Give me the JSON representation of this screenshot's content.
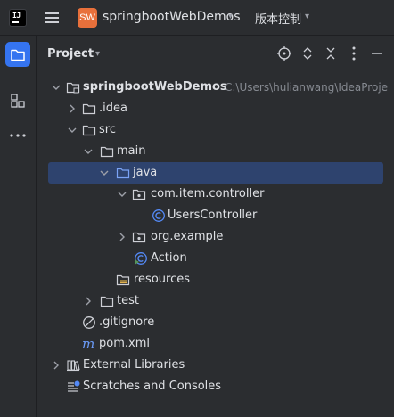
{
  "titlebar": {
    "logo_text": "IJ",
    "project_badge": "SW",
    "project_name": "springbootWebDemos",
    "vcs_label": "版本控制"
  },
  "panel": {
    "title": "Project"
  },
  "tree": {
    "root": {
      "label": "springbootWebDemos",
      "path": "C:\\Users\\hulianwang\\IdeaProje"
    },
    "idea": {
      "label": ".idea"
    },
    "src": {
      "label": "src"
    },
    "main": {
      "label": "main"
    },
    "java": {
      "label": "java"
    },
    "controller_pkg": {
      "label": "com.item.controller"
    },
    "users_controller": {
      "label": "UsersController"
    },
    "example_pkg": {
      "label": "org.example"
    },
    "action": {
      "label": "Action"
    },
    "resources": {
      "label": "resources"
    },
    "test": {
      "label": "test"
    },
    "gitignore": {
      "label": ".gitignore"
    },
    "pom": {
      "label": "pom.xml"
    },
    "external_libraries": {
      "label": "External Libraries"
    },
    "scratches": {
      "label": "Scratches and Consoles"
    }
  },
  "colors": {
    "accent": "#3574f0",
    "selection": "#2e436e",
    "class_icon": "#548af7",
    "maven_icon": "#6b9bf7"
  }
}
